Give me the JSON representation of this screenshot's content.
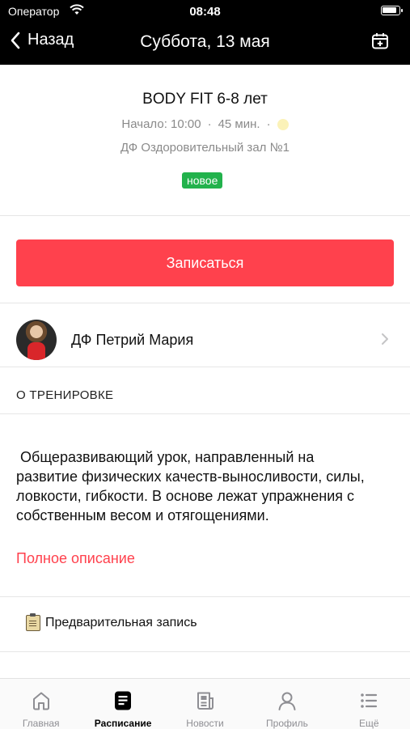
{
  "status_bar": {
    "carrier": "Оператор",
    "time": "08:48",
    "battery_level": 0.9
  },
  "nav": {
    "back_label": "Назад",
    "title": "Суббота, 13 мая",
    "calendar_icon": "calendar-plus-icon"
  },
  "class": {
    "title": "BODY FIT 6-8 лет",
    "start": "Начало: 10:00",
    "duration": "45 мин.",
    "separator": "·",
    "location": "ДФ Оздоровительный зал №1",
    "badge": "новое",
    "badge_color": "#22b24c"
  },
  "signup_button": {
    "label": "Записаться",
    "color": "#ff414d"
  },
  "trainer": {
    "name": "ДФ Петрий Мария"
  },
  "about": {
    "section_title": "О ТРЕНИРОВКЕ",
    "description": " Общеразвивающий урок, направленный на развитие физических качеств-выносливости, силы, ловкости, гибкости. В основе лежат упражнения с собственным весом и отягощениями.",
    "more_link": "Полное описание"
  },
  "prereg": {
    "label": "Предварительная запись",
    "icon": "clipboard-icon"
  },
  "tabs": [
    {
      "label": "Главная",
      "icon": "home-icon",
      "active": false
    },
    {
      "label": "Расписание",
      "icon": "schedule-icon",
      "active": true
    },
    {
      "label": "Новости",
      "icon": "news-icon",
      "active": false
    },
    {
      "label": "Профиль",
      "icon": "profile-icon",
      "active": false
    },
    {
      "label": "Ещё",
      "icon": "more-icon",
      "active": false
    }
  ]
}
